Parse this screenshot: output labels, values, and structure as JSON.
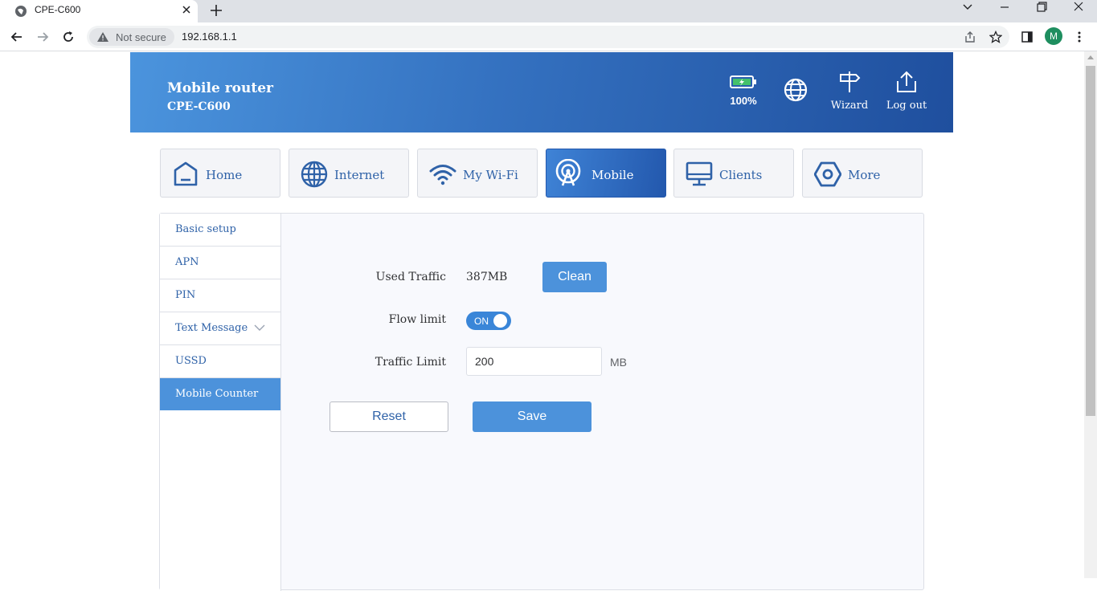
{
  "browser": {
    "tab_title": "CPE-C600",
    "security_label": "Not secure",
    "url": "192.168.1.1",
    "profile_initial": "M"
  },
  "header": {
    "brand_line1": "Mobile router",
    "brand_line2": "CPE-C600",
    "battery_label": "100%",
    "battery_level": 1.0,
    "wizard_label": "Wizard",
    "logout_label": "Log out"
  },
  "nav": {
    "tabs": [
      {
        "label": "Home",
        "icon": "home-icon",
        "active": false
      },
      {
        "label": "Internet",
        "icon": "globe-icon",
        "active": false
      },
      {
        "label": "My Wi-Fi",
        "icon": "wifi-icon",
        "active": false
      },
      {
        "label": "Mobile",
        "icon": "antenna-icon",
        "active": true
      },
      {
        "label": "Clients",
        "icon": "monitor-icon",
        "active": false
      },
      {
        "label": "More",
        "icon": "hexagon-icon",
        "active": false
      }
    ]
  },
  "sidebar": {
    "items": [
      {
        "label": "Basic setup",
        "active": false
      },
      {
        "label": "APN",
        "active": false
      },
      {
        "label": "PIN",
        "active": false
      },
      {
        "label": "Text Message",
        "active": false,
        "expandable": true
      },
      {
        "label": "USSD",
        "active": false
      },
      {
        "label": "Mobile Counter",
        "active": true
      }
    ]
  },
  "form": {
    "used_traffic_label": "Used Traffic",
    "used_traffic_value": "387MB",
    "clean_label": "Clean",
    "flow_limit_label": "Flow limit",
    "flow_limit_state": "ON",
    "traffic_limit_label": "Traffic Limit",
    "traffic_limit_value": "200",
    "traffic_limit_unit": "MB",
    "reset_label": "Reset",
    "save_label": "Save"
  },
  "colors": {
    "accent": "#4c92db",
    "header_start": "#4b94dd",
    "header_end": "#1f4f9e",
    "nav_text": "#2f62a8"
  }
}
